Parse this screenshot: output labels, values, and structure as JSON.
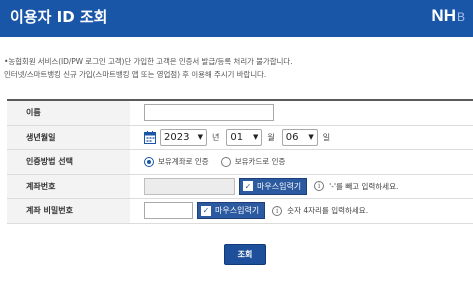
{
  "header": {
    "title": "이용자 ID 조회",
    "logo": "NH",
    "logo_tail": "B"
  },
  "notice": {
    "line1": "•농협회원 서비스(ID/PW 로그인 고객)단 가입한 고객은 인증서 발급/등록 처리가 불가합니다.",
    "line2": "인터넷/스마트뱅킹 신규 가입(스마트뱅킹 앱 또는 영업점) 후 이용해 주시기 바랍니다."
  },
  "form": {
    "name": {
      "label": "이름",
      "value": ""
    },
    "birth": {
      "label": "생년월일",
      "year": "2023",
      "year_unit": "년",
      "month": "01",
      "month_unit": "월",
      "day": "06",
      "day_unit": "일"
    },
    "auth_method": {
      "label": "인증방법 선택",
      "option_account": "보유계좌로 인증",
      "option_card": "보유카드로 인증",
      "selected": "보유계좌로 인증"
    },
    "account_number": {
      "label": "계좌번호",
      "value": "",
      "mouse_input": "마우스입력기",
      "hint": "'-'를 빼고 입력하세요."
    },
    "account_password": {
      "label": "계좌 비밀번호",
      "value": "",
      "mouse_input": "마우스입력기",
      "hint": "숫자 4자리를 입력하세요."
    }
  },
  "submit_label": "조회",
  "colors": {
    "header_bg": "#1a56a8",
    "button_bg": "#1e4f9a",
    "mouse_button_bg": "#2b5aa1"
  }
}
